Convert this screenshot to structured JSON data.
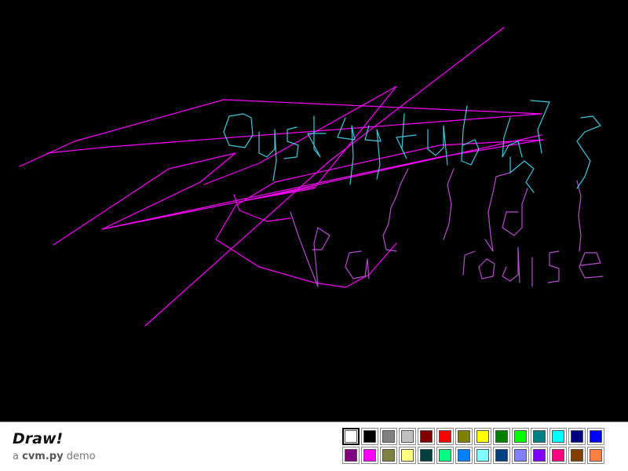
{
  "app": {
    "title": "Draw!",
    "subtitle_prefix": "a ",
    "subtitle_name": "cvm.py",
    "subtitle_suffix": " demo"
  },
  "canvas": {
    "background": "#000000"
  },
  "palette": {
    "selected_index": 0,
    "colors": [
      "#ffffff",
      "#000000",
      "#808080",
      "#c0c0c0",
      "#800000",
      "#ff0000",
      "#808000",
      "#ffff00",
      "#008000",
      "#00ff00",
      "#008080",
      "#00ffff",
      "#000080",
      "#0000ff",
      "#800080",
      "#ff00ff",
      "#808040",
      "#ffff80",
      "#004040",
      "#00ff80",
      "#0080ff",
      "#80ffff",
      "#004080",
      "#8080ff",
      "#8000ff",
      "#ff0080",
      "#804000",
      "#ff8040"
    ]
  },
  "strokes": {
    "magenta_color": "#ff00ff",
    "purple_color": "#b84dd0",
    "cyan_color": "#40c8e0"
  }
}
